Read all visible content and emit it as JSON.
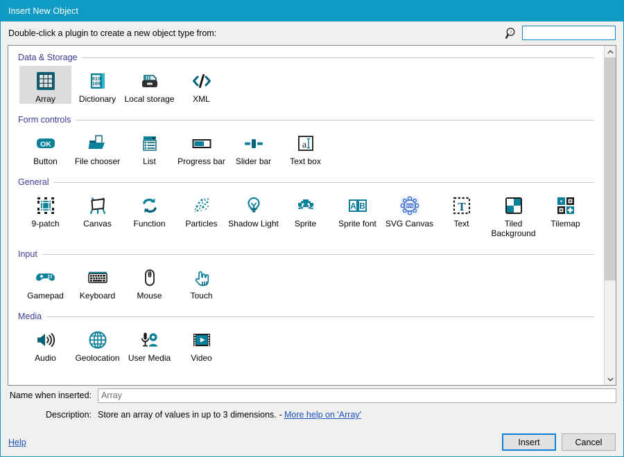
{
  "window": {
    "title": "Insert New Object",
    "accent_color": "#0f9bc4"
  },
  "header": {
    "prompt": "Double-click a plugin to create a new object type from:",
    "search_icon": "search-help-icon",
    "search_value": "",
    "search_placeholder": ""
  },
  "sections": [
    {
      "title": "Data & Storage",
      "items": [
        {
          "label": "Array",
          "icon": "array-grid-icon",
          "selected": true
        },
        {
          "label": "Dictionary",
          "icon": "dictionary-binary-book-icon",
          "selected": false
        },
        {
          "label": "Local storage",
          "icon": "local-storage-drive-icon",
          "selected": false
        },
        {
          "label": "XML",
          "icon": "xml-code-brackets-icon",
          "selected": false
        }
      ]
    },
    {
      "title": "Form controls",
      "items": [
        {
          "label": "Button",
          "icon": "button-ok-icon",
          "selected": false
        },
        {
          "label": "File chooser",
          "icon": "file-chooser-folder-icon",
          "selected": false
        },
        {
          "label": "List",
          "icon": "list-dropdown-icon",
          "selected": false
        },
        {
          "label": "Progress bar",
          "icon": "progress-bar-icon",
          "selected": false
        },
        {
          "label": "Slider bar",
          "icon": "slider-bar-icon",
          "selected": false
        },
        {
          "label": "Text box",
          "icon": "text-box-icon",
          "selected": false
        }
      ]
    },
    {
      "title": "General",
      "items": [
        {
          "label": "9-patch",
          "icon": "nine-patch-icon",
          "selected": false
        },
        {
          "label": "Canvas",
          "icon": "canvas-easel-icon",
          "selected": false
        },
        {
          "label": "Function",
          "icon": "function-arrows-icon",
          "selected": false
        },
        {
          "label": "Particles",
          "icon": "particles-icon",
          "selected": false
        },
        {
          "label": "Shadow Light",
          "icon": "shadow-light-bulb-icon",
          "selected": false
        },
        {
          "label": "Sprite",
          "icon": "sprite-invader-icon",
          "selected": false
        },
        {
          "label": "Sprite font",
          "icon": "sprite-font-ab-icon",
          "selected": false
        },
        {
          "label": "SVG Canvas",
          "icon": "svg-canvas-icon",
          "selected": false
        },
        {
          "label": "Text",
          "icon": "text-t-icon",
          "selected": false
        },
        {
          "label": "Tiled Background",
          "icon": "tiled-background-icon",
          "selected": false
        },
        {
          "label": "Tilemap",
          "icon": "tilemap-icon",
          "selected": false
        }
      ]
    },
    {
      "title": "Input",
      "items": [
        {
          "label": "Gamepad",
          "icon": "gamepad-icon",
          "selected": false
        },
        {
          "label": "Keyboard",
          "icon": "keyboard-icon",
          "selected": false
        },
        {
          "label": "Mouse",
          "icon": "mouse-icon",
          "selected": false
        },
        {
          "label": "Touch",
          "icon": "touch-hand-icon",
          "selected": false
        }
      ]
    },
    {
      "title": "Media",
      "items": [
        {
          "label": "Audio",
          "icon": "audio-speaker-icon",
          "selected": false
        },
        {
          "label": "Geolocation",
          "icon": "geolocation-globe-icon",
          "selected": false
        },
        {
          "label": "User Media",
          "icon": "user-media-mic-cam-icon",
          "selected": false
        },
        {
          "label": "Video",
          "icon": "video-film-icon",
          "selected": false
        }
      ]
    }
  ],
  "form": {
    "name_label": "Name when inserted:",
    "name_value": "Array",
    "description_label": "Description:",
    "description_text": "Store an array of values in up to 3 dimensions.",
    "description_separator": "-",
    "description_link": "More help on 'Array'"
  },
  "footer": {
    "help_label": "Help",
    "insert_label": "Insert",
    "cancel_label": "Cancel"
  },
  "scrollbar": {
    "up_arrow": "chevron-up-icon",
    "down_arrow": "chevron-down-icon"
  }
}
